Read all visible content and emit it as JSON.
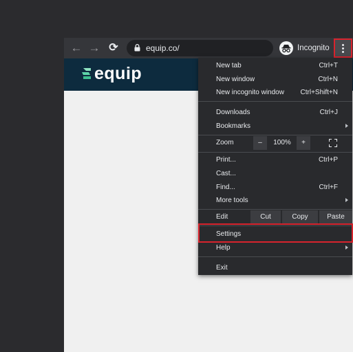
{
  "browser": {
    "url": "equip.co/",
    "profile_label": "Incognito",
    "back_icon": "arrow-left-icon",
    "forward_icon": "arrow-right-icon",
    "reload_icon": "reload-icon",
    "lock_icon": "lock-icon",
    "menu_icon": "three-dots-vertical-icon",
    "highlight_color": "#d9232d"
  },
  "site": {
    "logo_text": "equip",
    "header_color": "#0d2b3e",
    "accent_color": "#5fd4a8"
  },
  "menu": {
    "new_tab": {
      "label": "New tab",
      "shortcut": "Ctrl+T"
    },
    "new_window": {
      "label": "New window",
      "shortcut": "Ctrl+N"
    },
    "new_incognito": {
      "label": "New incognito window",
      "shortcut": "Ctrl+Shift+N"
    },
    "downloads": {
      "label": "Downloads",
      "shortcut": "Ctrl+J"
    },
    "bookmarks": {
      "label": "Bookmarks"
    },
    "zoom": {
      "label": "Zoom",
      "minus": "–",
      "value": "100%",
      "plus": "+"
    },
    "print": {
      "label": "Print...",
      "shortcut": "Ctrl+P"
    },
    "cast": {
      "label": "Cast..."
    },
    "find": {
      "label": "Find...",
      "shortcut": "Ctrl+F"
    },
    "more_tools": {
      "label": "More tools"
    },
    "edit": {
      "label": "Edit",
      "cut": "Cut",
      "copy": "Copy",
      "paste": "Paste"
    },
    "settings": {
      "label": "Settings"
    },
    "help": {
      "label": "Help"
    },
    "exit": {
      "label": "Exit"
    }
  }
}
